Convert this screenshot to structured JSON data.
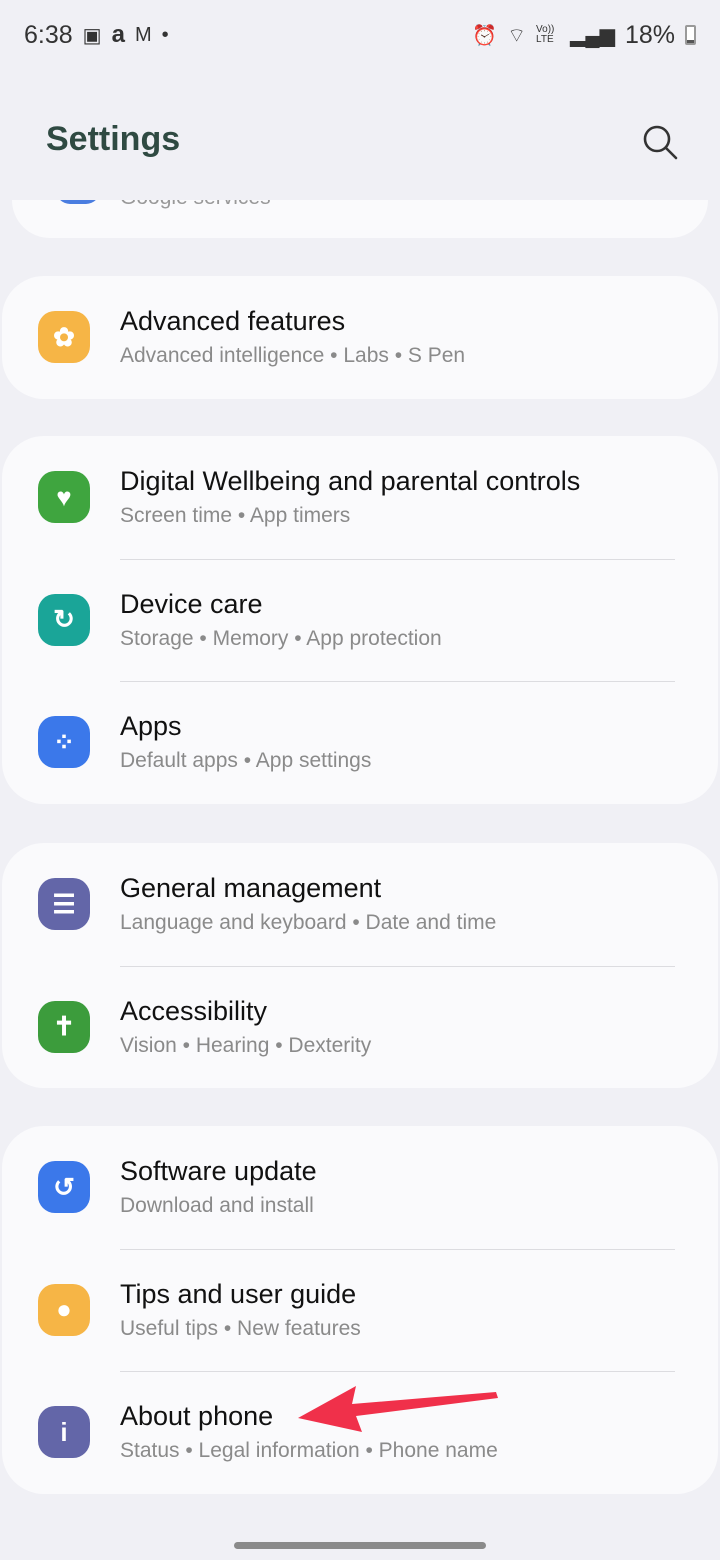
{
  "status_bar": {
    "time": "6:38",
    "battery": "18%",
    "left_icons": [
      "voicemail-icon",
      "amazon-icon",
      "gmail-icon",
      "dot-icon"
    ],
    "right_icons": [
      "alarm-icon",
      "wifi-icon",
      "volte-icon",
      "signal-icon",
      "battery-icon"
    ],
    "volte_label": "Vo)) LTE"
  },
  "header": {
    "title": "Settings"
  },
  "partial_item": {
    "subtitle": "Google services"
  },
  "groups": [
    [
      {
        "title": "Advanced features",
        "subtitle": "Advanced intelligence  •  Labs  •  S Pen",
        "icon": "advanced-features-icon",
        "color": "#f6b546"
      }
    ],
    [
      {
        "title": "Digital Wellbeing and parental controls",
        "subtitle": "Screen time  •  App timers",
        "icon": "digital-wellbeing-icon",
        "color": "#3fa53f"
      },
      {
        "title": "Device care",
        "subtitle": "Storage  •  Memory  •  App protection",
        "icon": "device-care-icon",
        "color": "#1aa598"
      },
      {
        "title": "Apps",
        "subtitle": "Default apps  •  App settings",
        "icon": "apps-icon",
        "color": "#3b78ea"
      }
    ],
    [
      {
        "title": "General management",
        "subtitle": "Language and keyboard  •  Date and time",
        "icon": "general-management-icon",
        "color": "#6366a8"
      },
      {
        "title": "Accessibility",
        "subtitle": "Vision  •  Hearing  •  Dexterity",
        "icon": "accessibility-icon",
        "color": "#3c9c3c"
      }
    ],
    [
      {
        "title": "Software update",
        "subtitle": "Download and install",
        "icon": "software-update-icon",
        "color": "#3b78ea"
      },
      {
        "title": "Tips and user guide",
        "subtitle": "Useful tips  •  New features",
        "icon": "tips-icon",
        "color": "#f6b546"
      },
      {
        "title": "About phone",
        "subtitle": "Status  •  Legal information  •  Phone name",
        "icon": "about-phone-icon",
        "color": "#6366a8"
      }
    ]
  ],
  "annotation": {
    "arrow_color": "#f0304a"
  }
}
